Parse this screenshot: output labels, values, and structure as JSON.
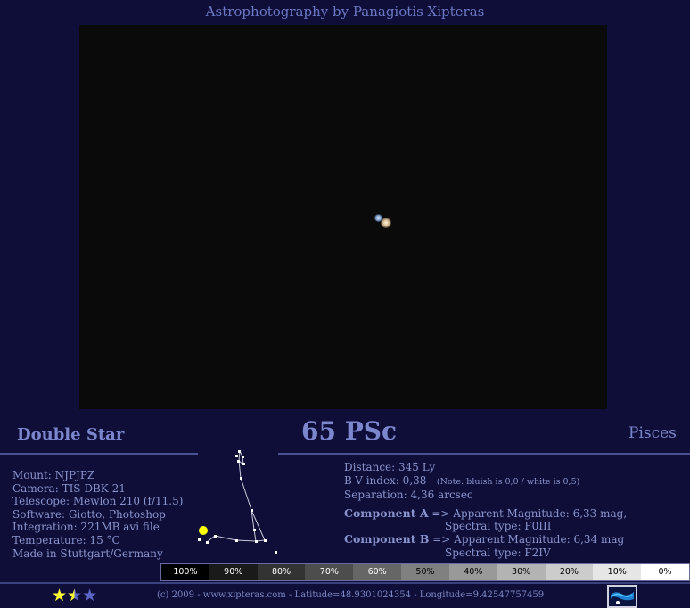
{
  "header": {
    "title": "Astrophotography by Panagiotis Xipteras"
  },
  "object": {
    "type": "Double Star",
    "name": "65 PSc",
    "constellation": "Pisces"
  },
  "equipment": [
    "Mount: NJPJPZ",
    "Camera: TIS DBK 21",
    "Telescope: Mewlon 210 (f/11.5)",
    "Software: Giotto, Photoshop",
    "Integration: 221MB avi file",
    "Temperature: 15 °C",
    "Made in Stuttgart/Germany"
  ],
  "star_info": {
    "distance": "Distance: 345 Ly",
    "bv_index": "B-V index: 0,38",
    "bv_note": "(Note: bluish is 0,0 / white is 0,5)",
    "separation": "Separation: 4,36 arcsec",
    "component_a": {
      "label": "Component A",
      "magnitude": "=> Apparent Magnitude: 6,33 mag,",
      "spectral": "Spectral type: F0III"
    },
    "component_b": {
      "label": "Component B",
      "magnitude": "=> Apparent Magnitude: 6,34 mag",
      "spectral": "Spectral type: F2IV"
    }
  },
  "scale": [
    {
      "label": "100%",
      "bg": "#000000",
      "fg": "#ffffff"
    },
    {
      "label": "90%",
      "bg": "#1a1a1a",
      "fg": "#ffffff"
    },
    {
      "label": "80%",
      "bg": "#333333",
      "fg": "#ffffff"
    },
    {
      "label": "70%",
      "bg": "#4d4d4d",
      "fg": "#ffffff"
    },
    {
      "label": "60%",
      "bg": "#666666",
      "fg": "#ffffff"
    },
    {
      "label": "50%",
      "bg": "#808080",
      "fg": "#000000"
    },
    {
      "label": "40%",
      "bg": "#999999",
      "fg": "#000000"
    },
    {
      "label": "30%",
      "bg": "#b3b3b3",
      "fg": "#000000"
    },
    {
      "label": "20%",
      "bg": "#cccccc",
      "fg": "#000000"
    },
    {
      "label": "10%",
      "bg": "#e6e6e6",
      "fg": "#000000"
    },
    {
      "label": "0%",
      "bg": "#ffffff",
      "fg": "#000000"
    }
  ],
  "rating": {
    "value": 1.5,
    "max": 3
  },
  "footer": {
    "copyright": "(c) 2009 - www.xipteras.com - Latitude=48.9301024354 - Longitude=9.42547757459"
  },
  "icons": {
    "star_full": "★",
    "star_half": "★",
    "star_empty": "★"
  }
}
